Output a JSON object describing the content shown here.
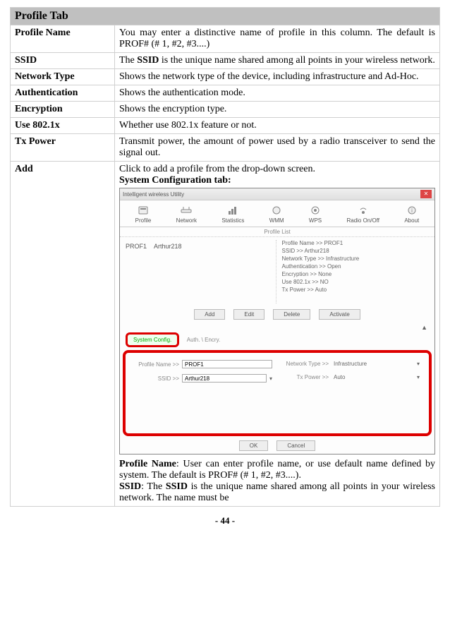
{
  "header": "Profile Tab",
  "rows": {
    "profileName": {
      "label": "Profile Name",
      "text": "You may enter a distinctive name of profile in this column. The default is PROF# (# 1, #2, #3....)"
    },
    "ssid": {
      "label": "SSID",
      "preBold": "The ",
      "bold": "SSID",
      "postBold": " is the unique name shared among all points in your wireless network."
    },
    "networkType": {
      "label": "Network Type",
      "text": "Shows the network type of the device, including infrastructure and Ad-Hoc."
    },
    "authentication": {
      "label": "Authentication",
      "text": "Shows the authentication mode."
    },
    "encryption": {
      "label": "Encryption",
      "text": "Shows the encryption type."
    },
    "use8021x": {
      "label": "Use 802.1x",
      "text": "Whether use 802.1x feature or not."
    },
    "txPower": {
      "label": "Tx Power",
      "text": "Transmit power, the amount of power used by a radio transceiver to send the signal out."
    },
    "add": {
      "label": "Add",
      "line1": "Click to add a profile from the drop-down screen.",
      "line2": "System Configuration tab:",
      "profBold": "Profile Name",
      "profText": ": User can enter profile name, or use default name defined by system. The default is PROF# (# 1, #2, #3....).",
      "ssidBold1": "SSID",
      "ssidMid": ": The ",
      "ssidBold2": "SSID",
      "ssidText": " is the unique name shared among all points in your wireless network. The name must be"
    }
  },
  "shot": {
    "title": "Intelligent wireless Utility",
    "toolbar": {
      "profile": "Profile",
      "network": "Network",
      "statistics": "Statistics",
      "wmm": "WMM",
      "wps": "WPS",
      "radio": "Radio On/Off",
      "about": "About"
    },
    "profileList": "Profile List",
    "listCol1": "PROF1",
    "listCol2": "Arthur218",
    "info": {
      "profileName": "Profile Name >> PROF1",
      "ssid": "SSID >> Arthur218",
      "networkType": "Network Type >> Infrastructure",
      "auth": "Authentication >> Open",
      "enc": "Encryption >> None",
      "use": "Use 802.1x >> NO",
      "tx": "Tx Power >> Auto"
    },
    "buttons": {
      "add": "Add",
      "edit": "Edit",
      "delete": "Delete",
      "activate": "Activate"
    },
    "tabs": {
      "active": "System Config.",
      "inactive": "Auth. \\ Encry."
    },
    "config": {
      "profileNameLabel": "Profile Name >>",
      "profileNameVal": "PROF1",
      "ssidLabel": "SSID >>",
      "ssidVal": "Arthur218",
      "netTypeLabel": "Network Type >>",
      "netTypeVal": "Infrastructure",
      "txLabel": "Tx Power >>",
      "txVal": "Auto"
    },
    "ok": "OK",
    "cancel": "Cancel"
  },
  "pageNum": "- 44 -"
}
